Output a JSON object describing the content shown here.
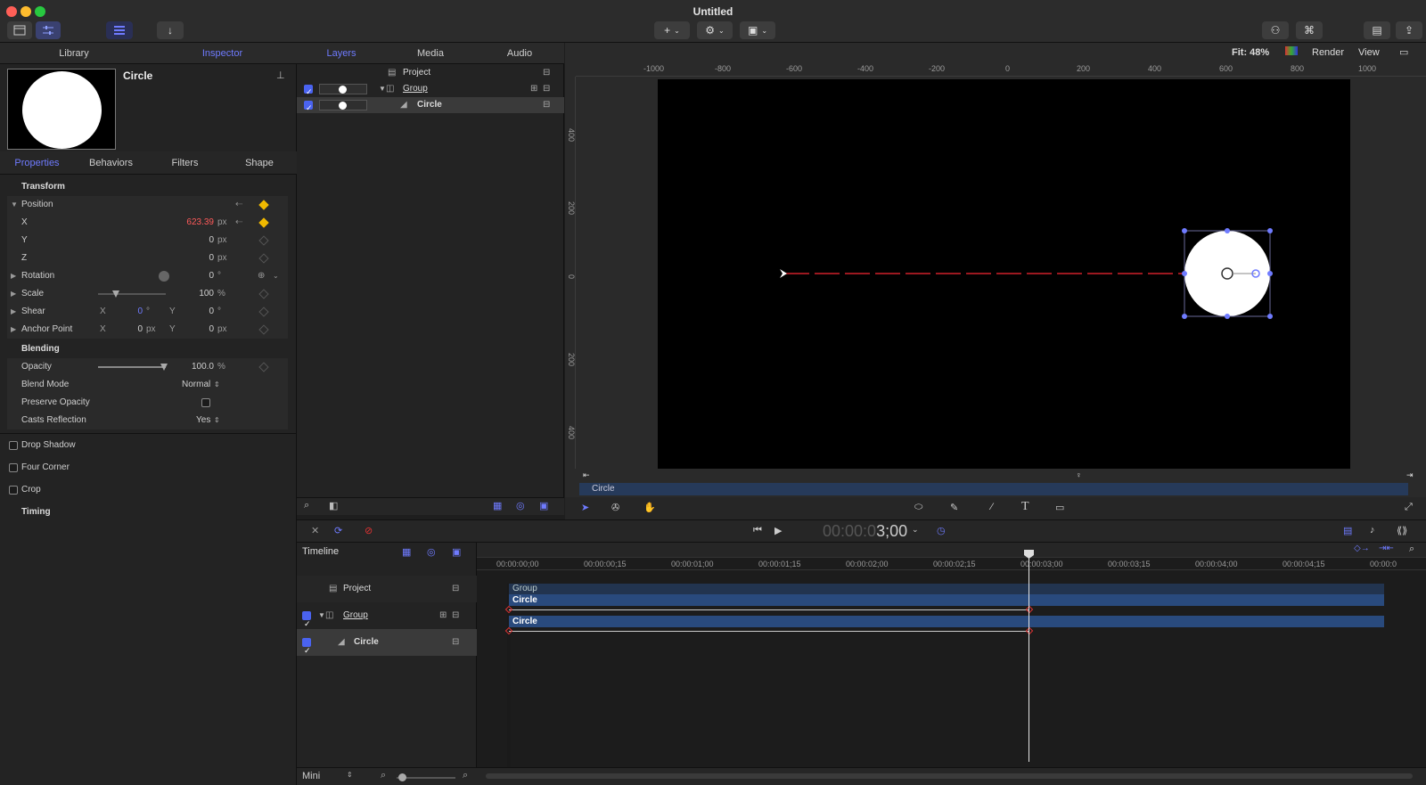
{
  "window": {
    "title": "Untitled"
  },
  "titlebar": {
    "add_label": "+",
    "fit_label": "Fit: 48%",
    "render_label": "Render",
    "view_label": "View"
  },
  "left_tabs": [
    {
      "label": "Library"
    },
    {
      "label": "Inspector"
    }
  ],
  "object_name": "Circle",
  "sub_tabs": [
    {
      "label": "Properties"
    },
    {
      "label": "Behaviors"
    },
    {
      "label": "Filters"
    },
    {
      "label": "Shape"
    }
  ],
  "properties": {
    "transform": "Transform",
    "position": "Position",
    "x_label": "X",
    "x_value": "623.39",
    "x_unit": "px",
    "y_label": "Y",
    "y_value": "0",
    "y_unit": "px",
    "z_label": "Z",
    "z_value": "0",
    "z_unit": "px",
    "rotation": "Rotation",
    "rotation_value": "0",
    "rotation_unit": "°",
    "scale": "Scale",
    "scale_value": "100",
    "scale_unit": "%",
    "shear": "Shear",
    "shear_x": "0",
    "shear_y": "0",
    "deg": "°",
    "anchor": "Anchor Point",
    "anchor_x": "0",
    "anchor_y": "0",
    "px": "px",
    "blending": "Blending",
    "opacity": "Opacity",
    "opacity_value": "100.0",
    "opacity_unit": "%",
    "blend_mode": "Blend Mode",
    "blend_mode_value": "Normal",
    "preserve_opacity": "Preserve Opacity",
    "casts_reflection": "Casts Reflection",
    "casts_reflection_value": "Yes",
    "drop_shadow": "Drop Shadow",
    "four_corner": "Four Corner",
    "crop": "Crop",
    "timing": "Timing",
    "xy_x": "X",
    "xy_y": "Y"
  },
  "layers_tabs": [
    {
      "label": "Layers"
    },
    {
      "label": "Media"
    },
    {
      "label": "Audio"
    }
  ],
  "layers": {
    "project": "Project",
    "group": "Group",
    "circle": "Circle"
  },
  "ruler_top": [
    "-1000",
    "-800",
    "-600",
    "-400",
    "-200",
    "0",
    "200",
    "400",
    "600",
    "800",
    "1000"
  ],
  "ruler_left": [
    "400",
    "200",
    "0",
    "200",
    "400"
  ],
  "canvas_label": "Circle",
  "transport": {
    "timecode_dim": "00:00:0",
    "timecode_bright": "3;00"
  },
  "timeline": {
    "title": "Timeline",
    "project": "Project",
    "group": "Group",
    "circle": "Circle",
    "ticks": [
      "00:00:00;00",
      "00:00:00;15",
      "00:00:01;00",
      "00:00:01;15",
      "00:00:02;00",
      "00:00:02;15",
      "00:00:03;00",
      "00:00:03;15",
      "00:00:04;00",
      "00:00:04;15",
      "00:00:0"
    ],
    "track_group": "Group",
    "track_circle_a": "Circle",
    "track_circle_b": "Circle",
    "size_label": "Mini"
  },
  "colors": {
    "accent": "#6f7bff",
    "keyframe": "#f0b900",
    "track": "#294a7d",
    "path": "#d0202a"
  }
}
